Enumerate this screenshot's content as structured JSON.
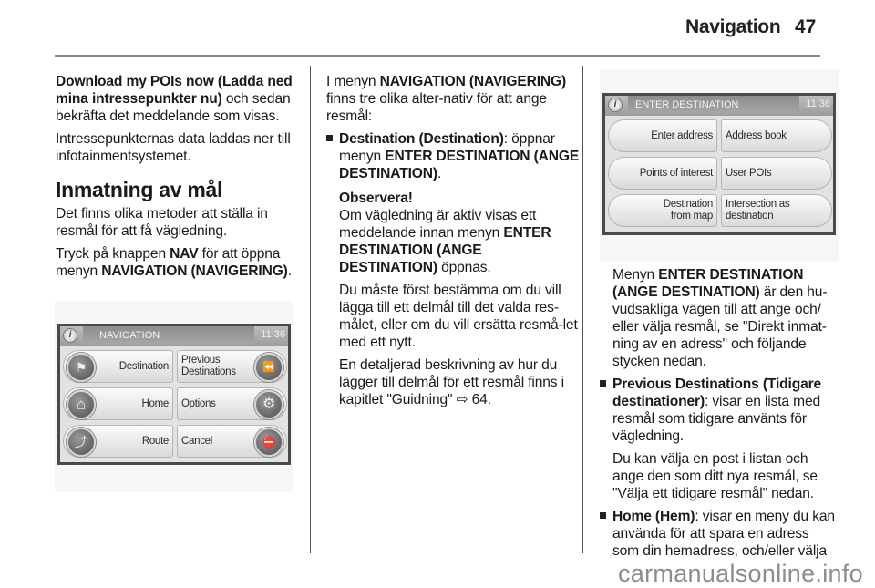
{
  "header": {
    "title": "Navigation",
    "page_number": "47"
  },
  "left_column": {
    "p1_bold": "Download my POIs now (Ladda ned mina intressepunkter nu)",
    "p1_rest": " och sedan bekräfta det meddelande som visas.",
    "p2": "Intressepunkternas data laddas ner till infotainmentsystemet.",
    "heading": "Inmatning av mål",
    "p3": "Det finns olika metoder att ställa in resmål för att få vägledning.",
    "p4_a": "Tryck på knappen ",
    "p4_b": "NAV",
    "p4_c": " för att öppna menyn ",
    "p4_d": "NAVIGATION (NAVIGERING)",
    "p4_e": "."
  },
  "nav_screen": {
    "title": "NAVIGATION",
    "clock": "11:36",
    "info_icon": "i",
    "buttons": [
      {
        "label": "Destination",
        "icon": "checkered-flag-icon",
        "glyph": "⚑"
      },
      {
        "label": "Previous Destinations",
        "icon": "flag-rewind-icon",
        "glyph": "⏪"
      },
      {
        "label": "Home",
        "icon": "home-icon",
        "glyph": "⌂"
      },
      {
        "label": "Options",
        "icon": "gears-icon",
        "glyph": "⚙"
      },
      {
        "label": "Route",
        "icon": "route-sign-icon",
        "glyph": "⤴"
      },
      {
        "label": "Cancel",
        "icon": "cancel-route-icon",
        "glyph": "⛔"
      }
    ]
  },
  "middle_column": {
    "p1_a": "I menyn ",
    "p1_b": "NAVIGATION (NAVIGERING)",
    "p1_c": " finns tre olika alter-nativ för att ange resmål:",
    "b1_bold": "Destination (Destination)",
    "b1_a": ": öppnar menyn ",
    "b1_b": "ENTER DESTINATION (ANGE DESTINATION)",
    "b1_c": ".",
    "note_title": "Observera!",
    "note_a": "Om vägledning är aktiv visas ett meddelande innan menyn ",
    "note_b": "ENTER DESTINATION (ANGE DESTINATION)",
    "note_c": " öppnas.",
    "p2": "Du måste först bestämma om du vill lägga till ett delmål till det valda res-målet, eller om du vill ersätta resmå-let med ett nytt.",
    "p3": "En detaljerad beskrivning av hur du lägger till delmål för ett resmål finns i kapitlet \"Guidning\" ⇨ 64."
  },
  "dest_screen": {
    "title": "ENTER DESTINATION",
    "clock": "11:36",
    "info_icon": "i",
    "buttons": [
      {
        "label": "Enter address"
      },
      {
        "label": "Address book"
      },
      {
        "label": "Points of interest"
      },
      {
        "label": "User POIs"
      },
      {
        "label": "Destination from map"
      },
      {
        "label": "Intersection as destination"
      }
    ]
  },
  "right_column": {
    "p1_a": "Menyn ",
    "p1_b": "ENTER DESTINATION (ANGE DESTINATION)",
    "p1_c": " är den hu-vudsakliga vägen till att ange och/ eller välja resmål, se \"Direkt inmat-ning av en adress\" och följande stycken nedan.",
    "b1_bold": "Previous Destinations (Tidigare destinationer)",
    "b1_rest": ": visar en lista med resmål som tidigare använts för vägledning.",
    "b1_p2": "Du kan välja en post i listan och ange den som ditt nya resmål, se \"Välja ett tidigare resmål\" nedan.",
    "b2_bold": "Home (Hem)",
    "b2_rest": ": visar en meny du kan använda för att spara en adress som din hemadress, och/eller välja"
  },
  "watermark": "carmanualsonline.info"
}
